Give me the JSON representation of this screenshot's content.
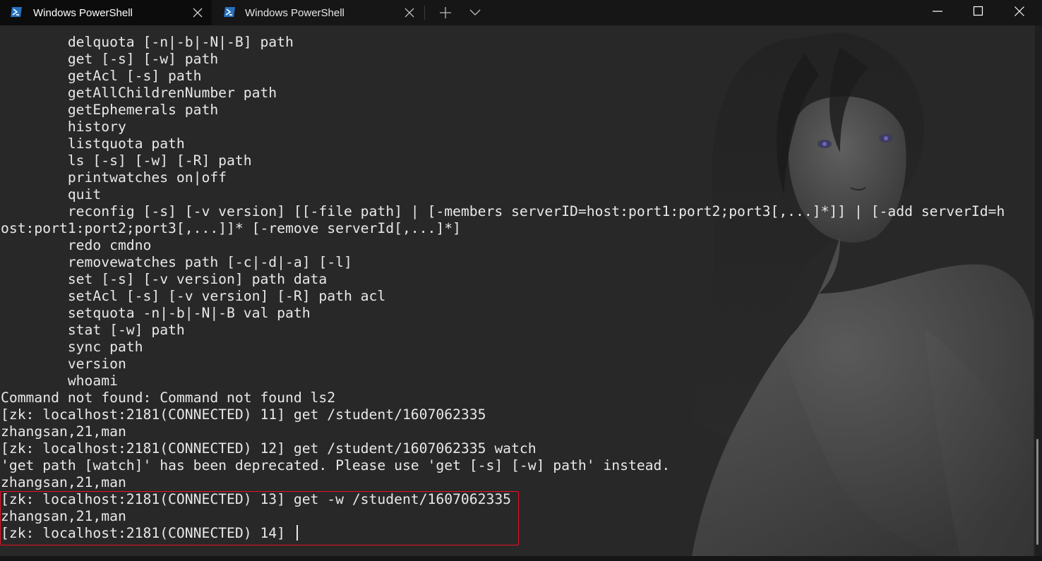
{
  "tabs": [
    {
      "title": "Windows PowerShell",
      "active": true
    },
    {
      "title": "Windows PowerShell",
      "active": false
    }
  ],
  "icons": {
    "tab_icon": "powershell-icon",
    "tab_close": "close-icon",
    "new_tab": "plus-icon",
    "dropdown": "chevron-down-icon",
    "minimize": "minimize-icon",
    "maximize": "maximize-icon",
    "close": "close-icon"
  },
  "colors": {
    "terminal_bg": "#282828",
    "text": "#e8e8e8",
    "highlight_border": "#e81123",
    "tab_active_bg": "#0c0c0c"
  },
  "terminal": {
    "lines": [
      "        delquota [-n|-b|-N|-B] path",
      "        get [-s] [-w] path",
      "        getAcl [-s] path",
      "        getAllChildrenNumber path",
      "        getEphemerals path",
      "        history",
      "        listquota path",
      "        ls [-s] [-w] [-R] path",
      "        printwatches on|off",
      "        quit",
      "        reconfig [-s] [-v version] [[-file path] | [-members serverID=host:port1:port2;port3[,...]*]] | [-add serverId=h",
      "ost:port1:port2;port3[,...]]* [-remove serverId[,...]*]",
      "        redo cmdno",
      "        removewatches path [-c|-d|-a] [-l]",
      "        set [-s] [-v version] path data",
      "        setAcl [-s] [-v version] [-R] path acl",
      "        setquota -n|-b|-N|-B val path",
      "        stat [-w] path",
      "        sync path",
      "        version",
      "        whoami",
      "Command not found: Command not found ls2",
      "[zk: localhost:2181(CONNECTED) 11] get /student/1607062335",
      "zhangsan,21,man",
      "[zk: localhost:2181(CONNECTED) 12] get /student/1607062335 watch",
      "'get path [watch]' has been deprecated. Please use 'get [-s] [-w] path' instead.",
      "zhangsan,21,man",
      "[zk: localhost:2181(CONNECTED) 13] get -w /student/1607062335",
      "zhangsan,21,man",
      "[zk: localhost:2181(CONNECTED) 14] "
    ]
  }
}
